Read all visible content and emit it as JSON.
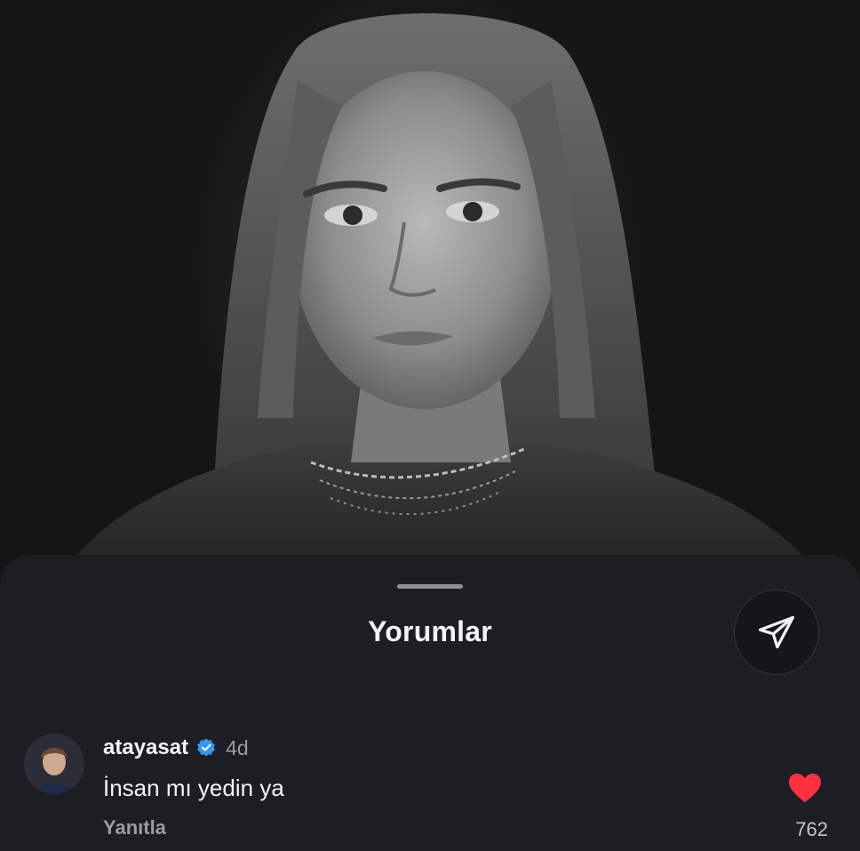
{
  "sheet": {
    "title": "Yorumlar"
  },
  "comment": {
    "username": "atayasat",
    "verified": true,
    "time": "4d",
    "text": "İnsan mı yedin ya",
    "reply_label": "Yanıtla",
    "like_count": "762",
    "liked": true
  },
  "icons": {
    "share": "send-paper-plane-icon",
    "verified": "verified-badge-icon",
    "like": "heart-icon"
  },
  "colors": {
    "sheet_bg": "#1c1e23",
    "verified_blue": "#3897f0",
    "heart_red": "#ff3040",
    "text_primary": "#f4f4f5",
    "text_secondary": "#9a9ca3"
  }
}
